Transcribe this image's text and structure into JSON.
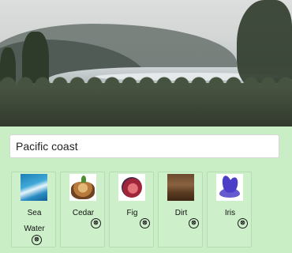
{
  "hero": {
    "icon": "coastal-photo"
  },
  "title_field": {
    "value": "Pacific coast"
  },
  "cards": [
    {
      "label_line1": "Sea",
      "label_line2": "Water",
      "thumb": "sea-wave-image"
    },
    {
      "label_line1": "Cedar",
      "label_line2": "",
      "thumb": "cedar-stump-image"
    },
    {
      "label_line1": "Fig",
      "label_line2": "",
      "thumb": "fig-fruit-image"
    },
    {
      "label_line1": "Dirt",
      "label_line2": "",
      "thumb": "dirt-image"
    },
    {
      "label_line1": "Iris",
      "label_line2": "",
      "thumb": "iris-flower-image"
    }
  ],
  "remove_icon": "⊗",
  "colors": {
    "panel_bg": "#c9eec6",
    "card_bg": "#cdf0ca"
  }
}
